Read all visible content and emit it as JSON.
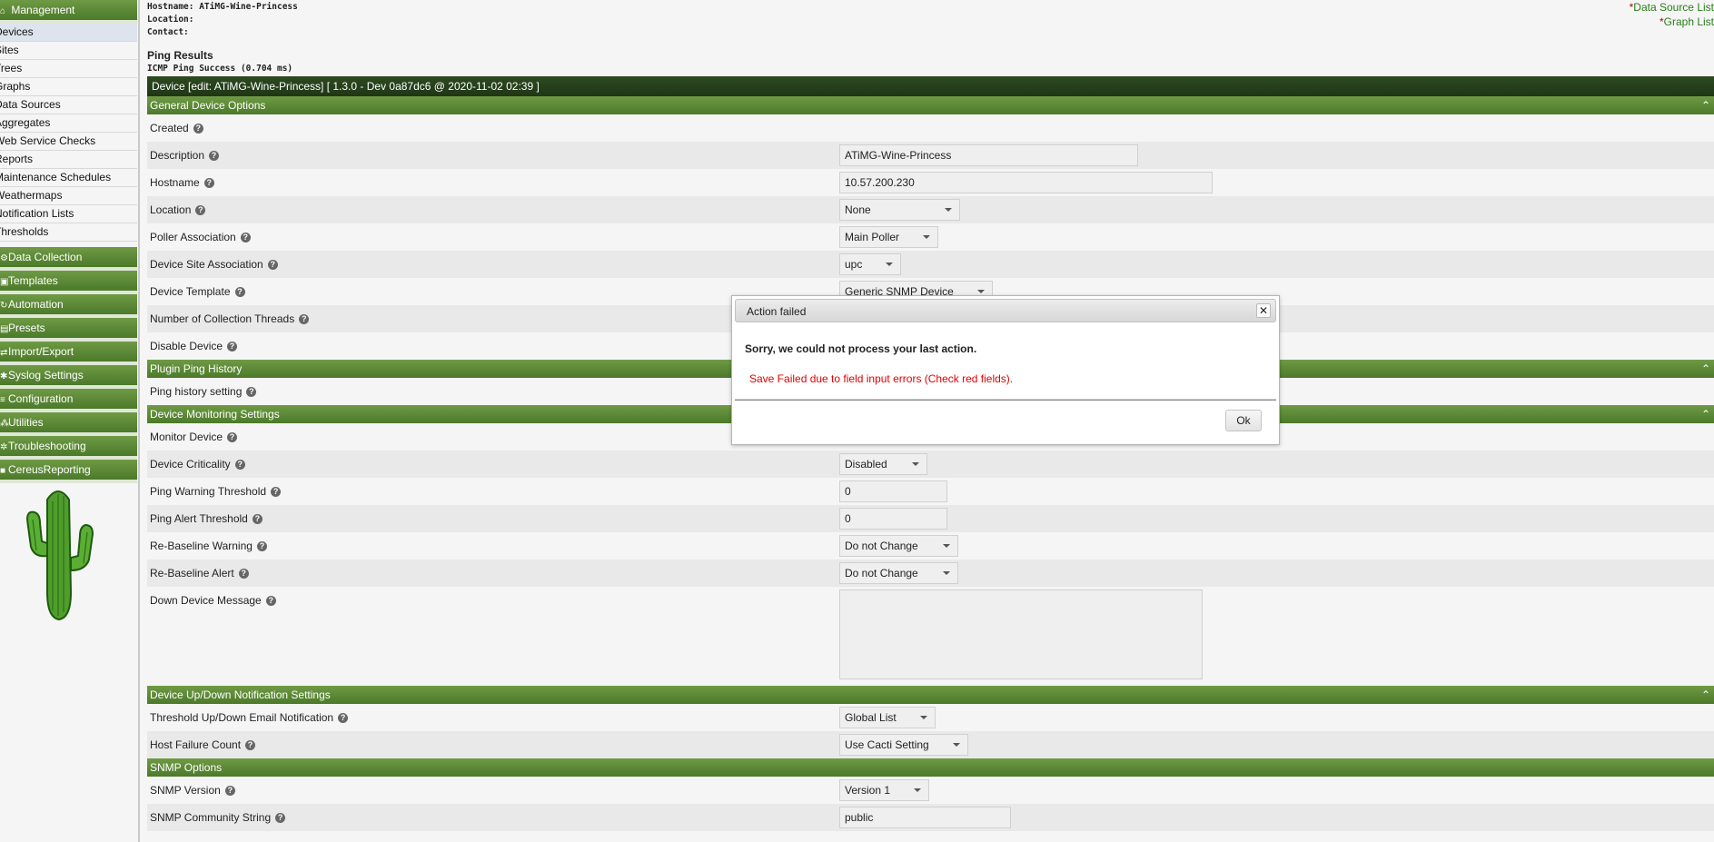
{
  "sidebar": {
    "management": {
      "icon": "home-icon",
      "label": "Management"
    },
    "items": [
      {
        "label": "Devices",
        "active": true
      },
      {
        "label": "Sites"
      },
      {
        "label": "Trees"
      },
      {
        "label": "Graphs"
      },
      {
        "label": "Data Sources"
      },
      {
        "label": "Aggregates"
      },
      {
        "label": "Web Service Checks"
      },
      {
        "label": "Reports"
      },
      {
        "label": "Maintenance Schedules"
      },
      {
        "label": "Weathermaps"
      },
      {
        "label": "Notification Lists"
      },
      {
        "label": "Thresholds"
      }
    ],
    "sections": [
      {
        "label": "Data Collection"
      },
      {
        "label": "Templates"
      },
      {
        "label": "Automation"
      },
      {
        "label": "Presets"
      },
      {
        "label": "Import/Export"
      },
      {
        "label": "Syslog Settings"
      },
      {
        "label": "Configuration"
      },
      {
        "label": "Utilities"
      },
      {
        "label": "Troubleshooting"
      },
      {
        "label": "CereusReporting"
      }
    ]
  },
  "host": {
    "hostname_line": "Hostname: ATiMG-Wine-Princess",
    "location_line": "Location:",
    "contact_line": "Contact:"
  },
  "links": {
    "data_source_list": "Data Source List",
    "graph_list": "Graph List",
    "star": "*"
  },
  "ping": {
    "title": "Ping Results",
    "status": "ICMP Ping Success (0.704 ms)"
  },
  "device_header": "Device [edit: ATiMG-Wine-Princess] [ 1.3.0 - Dev 0a87dc6 @ 2020-11-02 02:39 ]",
  "general": {
    "title": "General Device Options",
    "created": "Created",
    "description": {
      "label": "Description",
      "value": "ATiMG-Wine-Princess"
    },
    "hostname": {
      "label": "Hostname",
      "value": "10.57.200.230"
    },
    "location": {
      "label": "Location",
      "value": "None"
    },
    "poller": {
      "label": "Poller Association",
      "value": "Main Poller"
    },
    "site": {
      "label": "Device Site Association",
      "value": "upc"
    },
    "template": {
      "label": "Device Template",
      "value": "Generic SNMP Device"
    },
    "threads": {
      "label": "Number of Collection Threads"
    },
    "disable": {
      "label": "Disable Device"
    }
  },
  "plugin_ping": {
    "title": "Plugin Ping History",
    "setting": "Ping history setting"
  },
  "monitoring": {
    "title": "Device Monitoring Settings",
    "monitor": "Monitor Device",
    "criticality": {
      "label": "Device Criticality",
      "value": "Disabled"
    },
    "warn": {
      "label": "Ping Warning Threshold",
      "value": "0"
    },
    "alert": {
      "label": "Ping Alert Threshold",
      "value": "0"
    },
    "rebase_warn": {
      "label": "Re-Baseline Warning",
      "value": "Do not Change"
    },
    "rebase_alert": {
      "label": "Re-Baseline Alert",
      "value": "Do not Change"
    },
    "down_msg": {
      "label": "Down Device Message"
    }
  },
  "notification": {
    "title": "Device Up/Down Notification Settings",
    "threshold": {
      "label": "Threshold Up/Down Email Notification",
      "value": "Global List"
    },
    "failure": {
      "label": "Host Failure Count",
      "value": "Use Cacti Setting"
    }
  },
  "snmp": {
    "title": "SNMP Options",
    "version": {
      "label": "SNMP Version",
      "value": "Version 1"
    },
    "community": {
      "label": "SNMP Community String",
      "value": "public"
    }
  },
  "dialog": {
    "title": "Action failed",
    "close": "✕",
    "message": "Sorry, we could not process your last action.",
    "error": "Save Failed due to field input errors (Check red fields).",
    "ok": "Ok"
  },
  "colors": {
    "accent_green": "#4b7a2a",
    "header_dark": "#1f3616",
    "error_red": "#e00000"
  }
}
